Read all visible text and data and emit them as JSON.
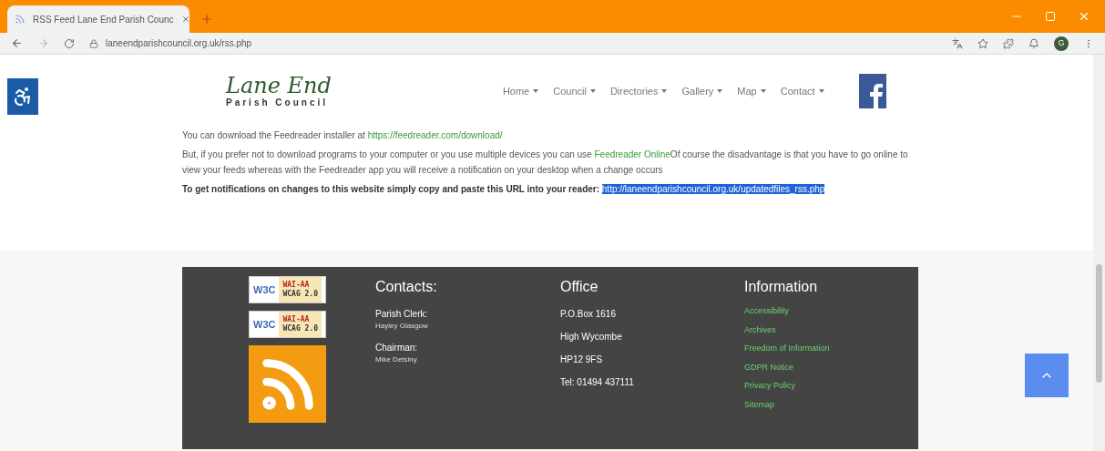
{
  "browser": {
    "tabs": [
      {
        "title": "RSS Feed Lane End Parish Counc",
        "selected": true
      }
    ],
    "url": "laneendparishcouncil.org.uk/rss.php",
    "profile": "G"
  },
  "header": {
    "logo_title": "Lane End",
    "logo_subtitle": "Parish Council",
    "nav": [
      {
        "label": "Home",
        "dropdown": true
      },
      {
        "label": "Council",
        "dropdown": true
      },
      {
        "label": "Directories",
        "dropdown": true
      },
      {
        "label": "Gallery",
        "dropdown": true
      },
      {
        "label": "Map",
        "dropdown": true
      },
      {
        "label": "Contact",
        "dropdown": true
      }
    ]
  },
  "content": {
    "download_text": "You can download the Feedreader installer at ",
    "download_link": "https://feedreader.com/download/",
    "paragraph_start": "But, if you prefer not to download programs to your computer or you use multiple devices you can use ",
    "online_link": "Feedreader Online",
    "paragraph_end": "Of course the disadvantage is that you have to go online to view your feeds whereas with the Feedreader app you will receive a notification on your desktop when a change occurs",
    "notify_text": "To get notifications on changes to this website simply copy and paste this URL into your reader:",
    "rss_url": {
      "text": "http://laneendparishcouncil.org.uk/updatedfiles_rss.php",
      "selected": true
    }
  },
  "footer": {
    "badges": [
      {
        "w3c": "W3C",
        "level": "WAI-AA",
        "standard": "WCAG 2.0"
      },
      {
        "w3c": "W3C",
        "level": "WAI-AA",
        "standard": "WCAG 2.0"
      }
    ],
    "contacts": {
      "title": "Contacts:",
      "entries": [
        {
          "role": "Parish Clerk:",
          "name": "Hayley Glasgow"
        },
        {
          "role": "Chairman:",
          "name": "Mike Detsiny"
        }
      ]
    },
    "office": {
      "title": "Office",
      "lines": [
        "P.O.Box 1616",
        "High Wycombe",
        "HP12 9FS",
        "Tel: 01494 437111"
      ]
    },
    "information": {
      "title": "Information",
      "links": [
        "Accessibility",
        "Archives",
        "Freedom of Information",
        "GDPR Notice",
        "Privacy Policy",
        "Sitemap"
      ]
    }
  }
}
